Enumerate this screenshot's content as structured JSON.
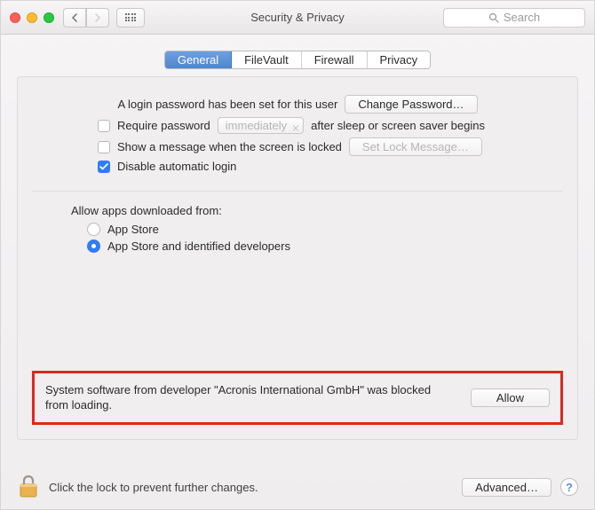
{
  "window": {
    "title": "Security & Privacy"
  },
  "search": {
    "placeholder": "Search"
  },
  "tabs": {
    "general": "General",
    "filevault": "FileVault",
    "firewall": "Firewall",
    "privacy": "Privacy"
  },
  "login": {
    "password_set": "A login password has been set for this user",
    "change_password": "Change Password…",
    "require_password": "Require password",
    "require_select": "immediately",
    "after": "after sleep or screen saver begins",
    "show_message": "Show a message when the screen is locked",
    "set_lock_msg": "Set Lock Message…",
    "disable_autologin": "Disable automatic login"
  },
  "gatekeeper": {
    "label": "Allow apps downloaded from:",
    "opt1": "App Store",
    "opt2": "App Store and identified developers"
  },
  "blocked": {
    "message": "System software from developer \"Acronis International GmbH\" was blocked from loading.",
    "allow": "Allow"
  },
  "footer": {
    "lock_text": "Click the lock to prevent further changes.",
    "advanced": "Advanced…"
  }
}
